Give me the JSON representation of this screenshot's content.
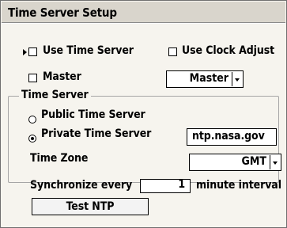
{
  "window": {
    "title": "Time Server Setup"
  },
  "options": {
    "use_time_server": {
      "label": "Use Time Server",
      "checked": false
    },
    "use_clock_adjust": {
      "label": "Use Clock Adjust",
      "checked": false
    },
    "master": {
      "label": "Master",
      "checked": false
    }
  },
  "master_select": {
    "value": "Master"
  },
  "time_server_group": {
    "title": "Time Server",
    "public_label": "Public Time Server",
    "private_label": "Private Time Server",
    "selected": "Private Time Server",
    "private_server_value": "ntp.nasa.gov",
    "time_zone_label": "Time Zone",
    "time_zone_value": "GMT"
  },
  "sync": {
    "label_before": "Synchronize every",
    "value": "1",
    "label_after": "minute interval"
  },
  "test_button": {
    "label": "Test NTP"
  }
}
